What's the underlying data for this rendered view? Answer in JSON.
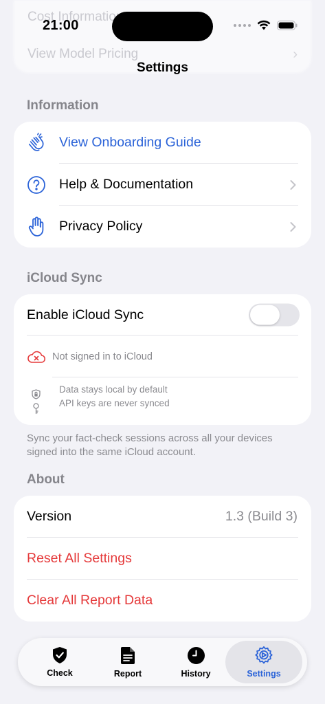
{
  "status_bar": {
    "time": "21:00"
  },
  "background_ghost": {
    "line1": "Cost Information",
    "line2": "View Model Pricing"
  },
  "nav": {
    "title": "Settings"
  },
  "information": {
    "header": "Information",
    "items": [
      {
        "label": "View Onboarding Guide",
        "icon": "clapping-hands-icon"
      },
      {
        "label": "Help & Documentation",
        "icon": "question-circle-icon"
      },
      {
        "label": "Privacy Policy",
        "icon": "raised-hand-icon"
      }
    ]
  },
  "icloud": {
    "header": "iCloud Sync",
    "toggle_label": "Enable iCloud Sync",
    "toggle_on": false,
    "status_text": "Not signed in to iCloud",
    "info_line1": "Data stays local by default",
    "info_line2": "API keys are never synced",
    "footer": "Sync your fact-check sessions across all your devices signed into the same iCloud account."
  },
  "about": {
    "header": "About",
    "version_label": "Version",
    "version_value": "1.3 (Build 3)",
    "reset_label": "Reset All Settings",
    "clear_label": "Clear All Report Data"
  },
  "tabs": [
    {
      "label": "Check",
      "icon": "shield-check-icon",
      "active": false
    },
    {
      "label": "Report",
      "icon": "document-icon",
      "active": false
    },
    {
      "label": "History",
      "icon": "clock-icon",
      "active": false
    },
    {
      "label": "Settings",
      "icon": "gear-icon",
      "active": true
    }
  ],
  "colors": {
    "accent": "#2b63d8",
    "destructive": "#e5393a",
    "background": "#f2f2f7"
  }
}
